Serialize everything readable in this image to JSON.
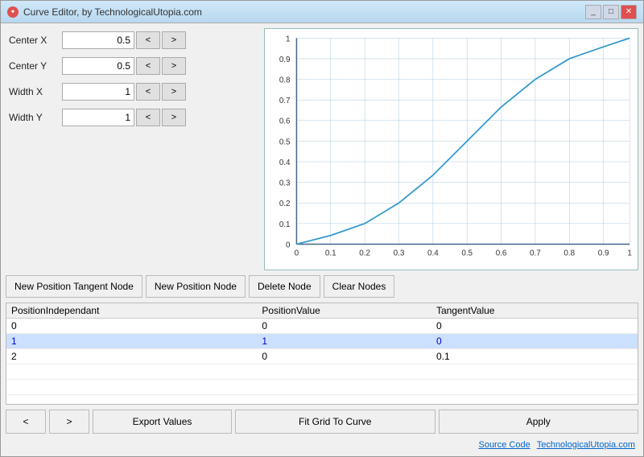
{
  "titleBar": {
    "title": "Curve Editor, by TechnologicalUtopia.com",
    "minimizeLabel": "_",
    "maximizeLabel": "□",
    "closeLabel": "✕"
  },
  "controls": {
    "centerX": {
      "label": "Center X",
      "value": "0.5"
    },
    "centerY": {
      "label": "Center Y",
      "value": "0.5"
    },
    "widthX": {
      "label": "Width X",
      "value": "1"
    },
    "widthY": {
      "label": "Width Y",
      "value": "1"
    },
    "decrementLabel": "<",
    "incrementLabel": ">"
  },
  "buttons": {
    "newPositionTangentNode": "New Position Tangent Node",
    "newPositionNode": "New Position Node",
    "deleteNode": "Delete Node",
    "clearNodes": "Clear Nodes"
  },
  "table": {
    "headers": [
      "PositionIndependant",
      "PositionValue",
      "TangentValue"
    ],
    "rows": [
      {
        "posIndep": "0",
        "posVal": "0",
        "tangent": "0",
        "selected": false
      },
      {
        "posIndep": "1",
        "posVal": "1",
        "tangent": "0",
        "selected": true
      },
      {
        "posIndep": "2",
        "posVal": "0",
        "tangent": "0.1",
        "selected": false
      }
    ]
  },
  "bottomBar": {
    "prev": "<",
    "next": ">",
    "exportValues": "Export Values",
    "fitGridToCurve": "Fit Grid To Curve",
    "apply": "Apply"
  },
  "footer": {
    "sourceCode": "Source Code",
    "website": "TechnologicalUtopia.com"
  },
  "chart": {
    "xLabels": [
      "0",
      "0.1",
      "0.2",
      "0.3",
      "0.4",
      "0.5",
      "0.6",
      "0.7",
      "0.8",
      "0.9",
      "1"
    ],
    "yLabels": [
      "0",
      "0.1",
      "0.2",
      "0.3",
      "0.4",
      "0.5",
      "0.6",
      "0.7",
      "0.8",
      "0.9",
      "1"
    ]
  }
}
